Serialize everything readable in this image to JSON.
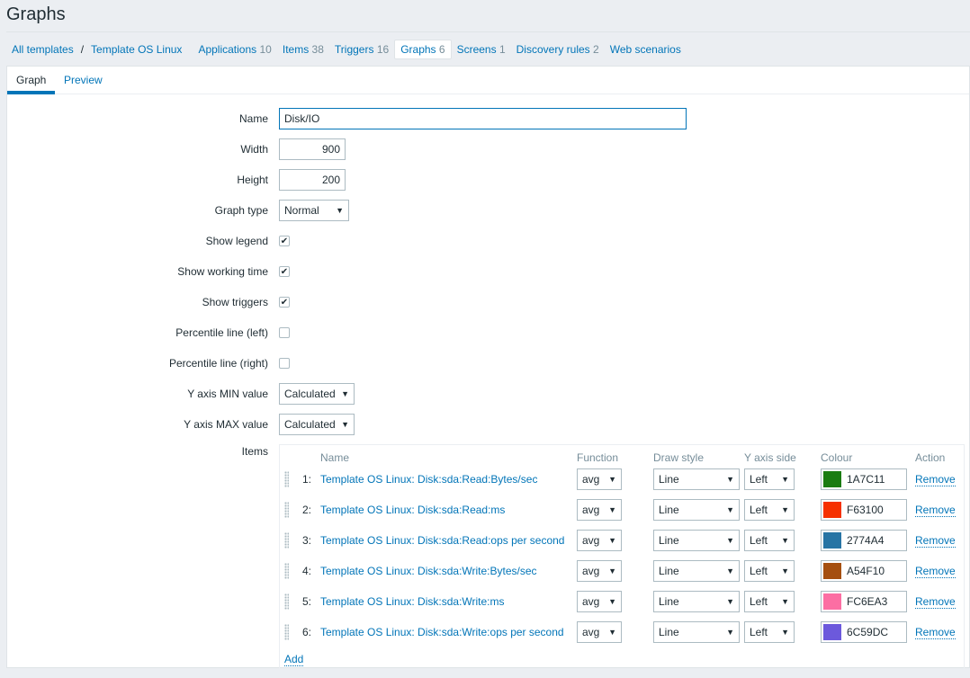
{
  "page_title": "Graphs",
  "nav": {
    "all_templates": "All templates",
    "separator": "/",
    "template": "Template OS Linux",
    "links": [
      {
        "label": "Applications",
        "count": "10"
      },
      {
        "label": "Items",
        "count": "38"
      },
      {
        "label": "Triggers",
        "count": "16"
      },
      {
        "label": "Graphs",
        "count": "6",
        "active": true
      },
      {
        "label": "Screens",
        "count": "1"
      },
      {
        "label": "Discovery rules",
        "count": "2"
      },
      {
        "label": "Web scenarios",
        "count": ""
      }
    ]
  },
  "tabs": {
    "graph": "Graph",
    "preview": "Preview"
  },
  "form": {
    "name_label": "Name",
    "name_value": "Disk/IO",
    "width_label": "Width",
    "width_value": "900",
    "height_label": "Height",
    "height_value": "200",
    "graph_type_label": "Graph type",
    "graph_type_value": "Normal",
    "show_legend_label": "Show legend",
    "show_legend": true,
    "show_working_time_label": "Show working time",
    "show_working_time": true,
    "show_triggers_label": "Show triggers",
    "show_triggers": true,
    "percentile_left_label": "Percentile line (left)",
    "percentile_left": false,
    "percentile_right_label": "Percentile line (right)",
    "percentile_right": false,
    "ymin_label": "Y axis MIN value",
    "ymin_value": "Calculated",
    "ymax_label": "Y axis MAX value",
    "ymax_value": "Calculated",
    "items_label": "Items"
  },
  "items": {
    "headers": {
      "name": "Name",
      "function": "Function",
      "draw_style": "Draw style",
      "y_axis_side": "Y axis side",
      "colour": "Colour",
      "action": "Action"
    },
    "rows": [
      {
        "num": "1:",
        "name": "Template OS Linux: Disk:sda:Read:Bytes/sec",
        "function": "avg",
        "draw_style": "Line",
        "y_axis_side": "Left",
        "colour": "1A7C11",
        "remove": "Remove"
      },
      {
        "num": "2:",
        "name": "Template OS Linux: Disk:sda:Read:ms",
        "function": "avg",
        "draw_style": "Line",
        "y_axis_side": "Left",
        "colour": "F63100",
        "remove": "Remove"
      },
      {
        "num": "3:",
        "name": "Template OS Linux: Disk:sda:Read:ops per second",
        "function": "avg",
        "draw_style": "Line",
        "y_axis_side": "Left",
        "colour": "2774A4",
        "remove": "Remove"
      },
      {
        "num": "4:",
        "name": "Template OS Linux: Disk:sda:Write:Bytes/sec",
        "function": "avg",
        "draw_style": "Line",
        "y_axis_side": "Left",
        "colour": "A54F10",
        "remove": "Remove"
      },
      {
        "num": "5:",
        "name": "Template OS Linux: Disk:sda:Write:ms",
        "function": "avg",
        "draw_style": "Line",
        "y_axis_side": "Left",
        "colour": "FC6EA3",
        "remove": "Remove"
      },
      {
        "num": "6:",
        "name": "Template OS Linux: Disk:sda:Write:ops per second",
        "function": "avg",
        "draw_style": "Line",
        "y_axis_side": "Left",
        "colour": "6C59DC",
        "remove": "Remove"
      }
    ],
    "add": "Add"
  }
}
